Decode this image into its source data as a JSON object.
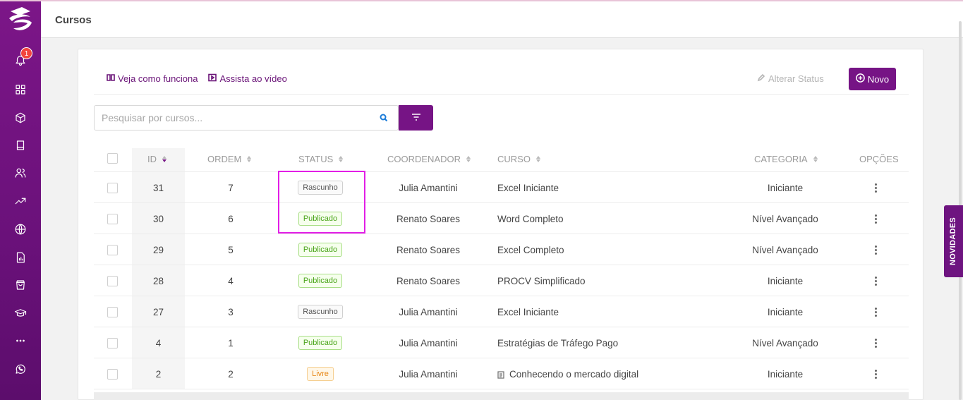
{
  "header": {
    "title": "Cursos"
  },
  "sidebar": {
    "notification_count": "1"
  },
  "toolbar": {
    "link_how": "Veja como funciona",
    "link_video": "Assista ao vídeo",
    "alter_status": "Alterar Status",
    "new_label": "Novo"
  },
  "search": {
    "placeholder": "Pesquisar por cursos..."
  },
  "table": {
    "headers": {
      "id": "ID",
      "ordem": "ORDEM",
      "status": "STATUS",
      "coordenador": "COORDENADOR",
      "curso": "CURSO",
      "categoria": "CATEGORIA",
      "opcoes": "OPÇÕES"
    },
    "rows": [
      {
        "id": "31",
        "ordem": "7",
        "status": "Rascunho",
        "coordenador": "Julia Amantini",
        "curso": "Excel Iniciante",
        "categoria": "Iniciante"
      },
      {
        "id": "30",
        "ordem": "6",
        "status": "Publicado",
        "coordenador": "Renato Soares",
        "curso": "Word Completo",
        "categoria": "Nível Avançado"
      },
      {
        "id": "29",
        "ordem": "5",
        "status": "Publicado",
        "coordenador": "Renato Soares",
        "curso": "Excel Completo",
        "categoria": "Nível Avançado"
      },
      {
        "id": "28",
        "ordem": "4",
        "status": "Publicado",
        "coordenador": "Renato Soares",
        "curso": "PROCV Simplificado",
        "categoria": "Iniciante"
      },
      {
        "id": "27",
        "ordem": "3",
        "status": "Rascunho",
        "coordenador": "Julia Amantini",
        "curso": "Excel Iniciante",
        "categoria": "Iniciante"
      },
      {
        "id": "4",
        "ordem": "1",
        "status": "Publicado",
        "coordenador": "Julia Amantini",
        "curso": "Estratégias de Tráfego Pago",
        "categoria": "Nível Avançado"
      },
      {
        "id": "2",
        "ordem": "2",
        "status": "Livre",
        "coordenador": "Julia Amantini",
        "curso": "Conhecendo o mercado digital",
        "categoria": "Iniciante"
      }
    ]
  },
  "novidades": "NOVIDADES",
  "colors": {
    "brand": "#761485",
    "publicado": "#4aa51a",
    "livre": "#e8891a",
    "highlight": "#e21ee6"
  }
}
